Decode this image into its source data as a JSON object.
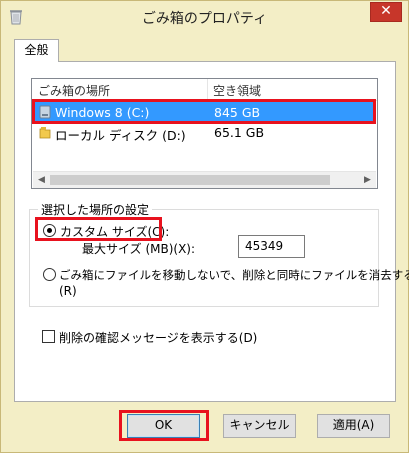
{
  "window": {
    "title": "ごみ箱のプロパティ",
    "close_glyph": "✕"
  },
  "tab": {
    "label": "全般"
  },
  "listview": {
    "columns": [
      "ごみ箱の場所",
      "空き領域"
    ],
    "rows": [
      {
        "name": "Windows 8 (C:)",
        "free": "845 GB",
        "selected": true
      },
      {
        "name": "ローカル ディスク (D:)",
        "free": "65.1 GB",
        "selected": false
      }
    ]
  },
  "settings": {
    "group_label": "選択した場所の設定",
    "custom_size_label": "カスタム サイズ(C):",
    "max_size_label": "最大サイズ (MB)(X):",
    "max_size_value": "45349",
    "no_move_label_line1": "ごみ箱にファイルを移動しないで、削除と同時にファイルを消去する",
    "no_move_label_line2": "(R)",
    "confirm_delete_label": "削除の確認メッセージを表示する(D)"
  },
  "buttons": {
    "ok": "OK",
    "cancel": "キャンセル",
    "apply": "適用(A)"
  },
  "colors": {
    "selection": "#3399ff",
    "highlight_box": "#e8121e",
    "close_button": "#c7362a"
  }
}
